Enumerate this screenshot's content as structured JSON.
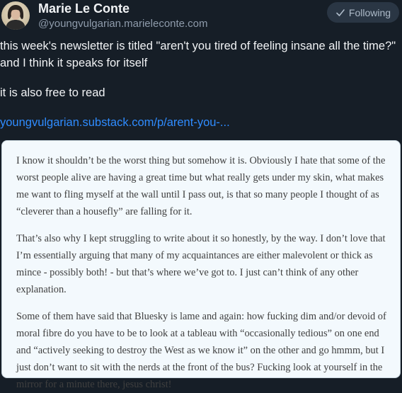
{
  "author": {
    "display_name": "Marie Le Conte",
    "handle": "@youngvulgarian.marieleconte.com",
    "avatar_icon": "avatar-portrait-icon"
  },
  "follow_button": {
    "label": "Following",
    "icon": "check-icon"
  },
  "post": {
    "text_line_1": "this week's newsletter is titled \"aren't you tired of feeling insane all the time?\" and I think it speaks for itself",
    "text_line_2": "it is also free to read",
    "link_text": "youngvulgarian.substack.com/p/arent-you-..."
  },
  "embedded_image": {
    "paragraphs": [
      "I know it shouldn’t be the worst thing but somehow it is. Obviously I hate that some of the worst people alive are having a great time but what really gets under my skin, what makes me want to fling myself at the wall until I pass out, is that so many people I thought of as “cleverer than a housefly” are falling for it.",
      "That’s also why I kept struggling to write about it so honestly, by the way. I don’t love that I’m essentially arguing that many of my acquaintances are either malevolent or thick as mince - possibly both! - but that’s where we’ve got to. I just can’t think of any other explanation.",
      "Some of them have said that Bluesky is lame and again: how fucking dim and/or devoid of moral fibre do you have to be to look at a tableau with “occasionally tedious” on one end and “actively seeking to destroy the West as we know it” on the other and go hmmm, but I just don’t want to sit with the nerds at the front of the bus? Fucking look at yourself in the mirror for a minute there, jesus christ!"
    ]
  },
  "colors": {
    "background": "#161e27",
    "link": "#2f8cff",
    "muted": "#8e9bab",
    "button_bg": "#2a3644"
  }
}
